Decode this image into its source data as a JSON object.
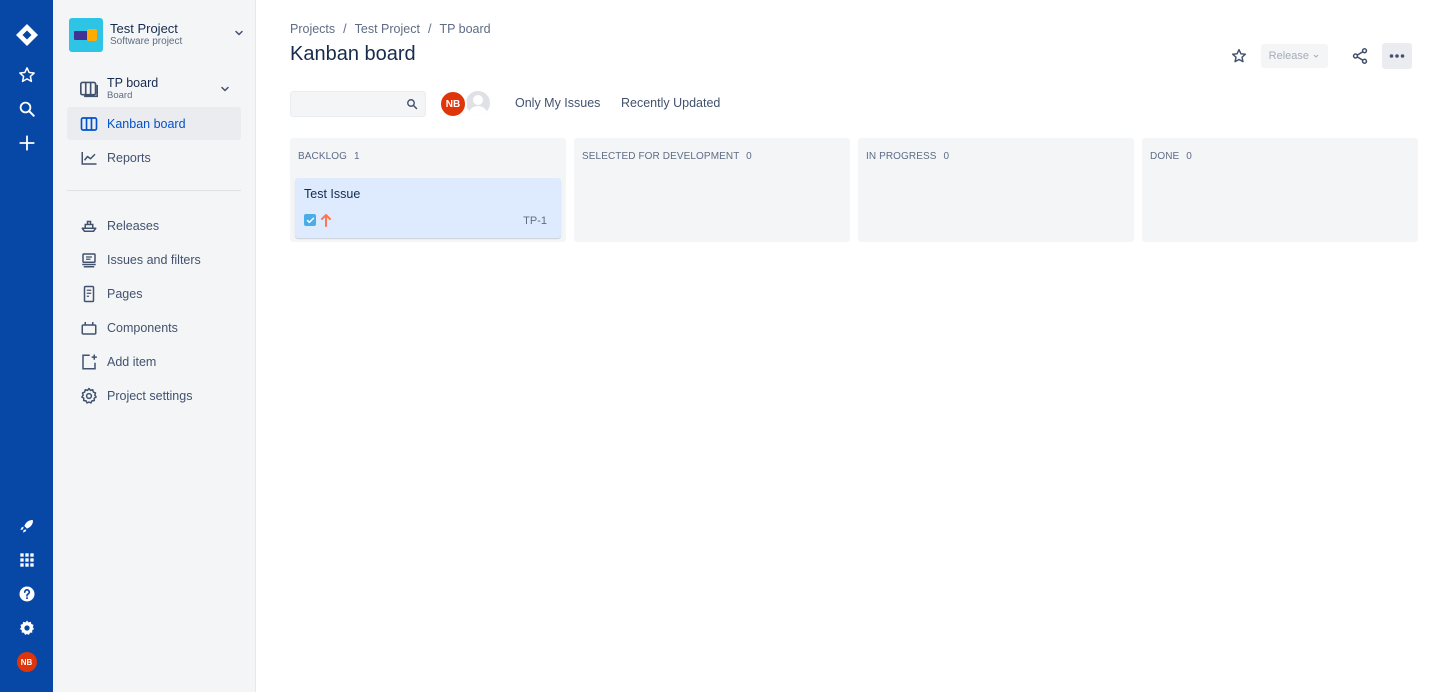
{
  "global_nav": {
    "top_icons": [
      "jira-logo-icon",
      "star-icon",
      "search-icon",
      "plus-icon"
    ],
    "bottom_icons": [
      "rocket-icon",
      "app-switcher-icon",
      "help-icon",
      "gear-icon"
    ],
    "user_initials": "NB"
  },
  "project": {
    "name": "Test Project",
    "type": "Software project"
  },
  "board_selector": {
    "name": "TP board",
    "type": "Board"
  },
  "sidebar": {
    "primary": [
      {
        "label": "Kanban board",
        "icon": "board-columns-icon",
        "active": true
      },
      {
        "label": "Reports",
        "icon": "chart-line-icon",
        "active": false
      }
    ],
    "secondary": [
      {
        "label": "Releases",
        "icon": "ship-icon"
      },
      {
        "label": "Issues and filters",
        "icon": "issues-icon"
      },
      {
        "label": "Pages",
        "icon": "page-icon"
      },
      {
        "label": "Components",
        "icon": "component-icon"
      },
      {
        "label": "Add item",
        "icon": "add-item-icon"
      },
      {
        "label": "Project settings",
        "icon": "gear-icon"
      }
    ]
  },
  "breadcrumb": [
    "Projects",
    "Test Project",
    "TP board"
  ],
  "breadcrumb_separator": "/",
  "page_title": "Kanban board",
  "header_actions": {
    "release_label": "Release",
    "release_disabled": true
  },
  "filters": {
    "search_value": "",
    "user_initials": "NB",
    "quick_filters": [
      "Only My Issues",
      "Recently Updated"
    ]
  },
  "columns": [
    {
      "title": "BACKLOG",
      "count": "1",
      "cards": [
        {
          "title": "Test Issue",
          "key": "TP-1",
          "type": "task",
          "priority": "high"
        }
      ]
    },
    {
      "title": "SELECTED FOR DEVELOPMENT",
      "count": "0",
      "cards": []
    },
    {
      "title": "IN PROGRESS",
      "count": "0",
      "cards": []
    },
    {
      "title": "DONE",
      "count": "0",
      "cards": []
    }
  ],
  "colors": {
    "global_nav_bg": "#0747a6",
    "sidebar_bg": "#f4f5f7",
    "accent": "#0052cc",
    "avatar": "#de350b",
    "card_selected": "#deebff",
    "priority_high": "#ff7452"
  }
}
